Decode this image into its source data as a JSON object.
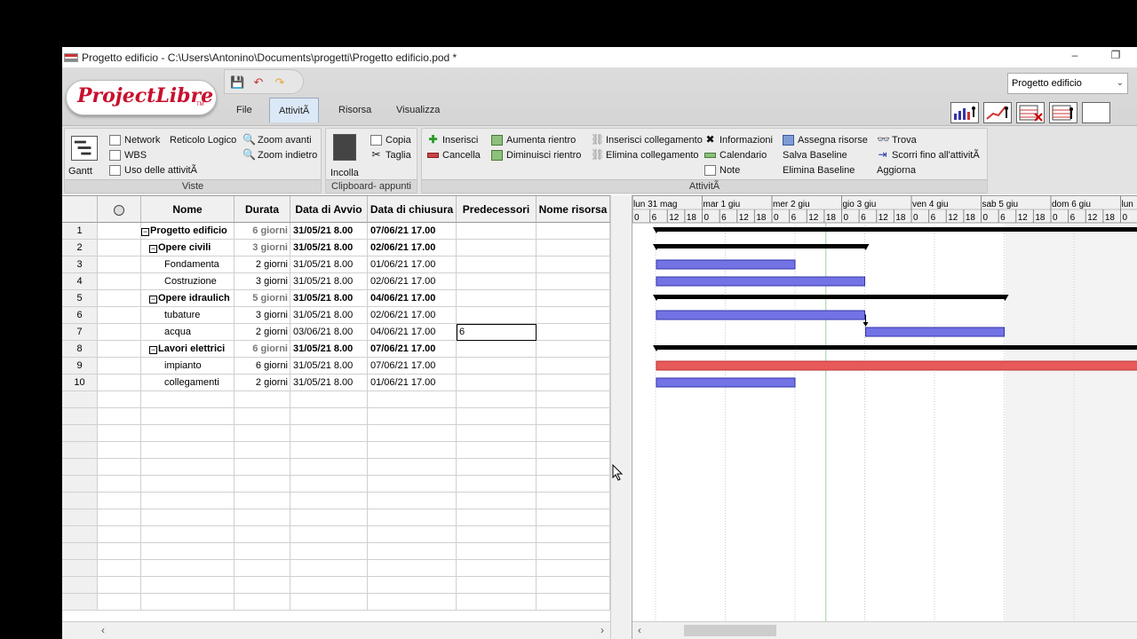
{
  "window": {
    "title": "Progetto edificio - C:\\Users\\Antonino\\Documents\\progetti\\Progetto edificio.pod *",
    "minimize": "–",
    "restore": "❐"
  },
  "logo": {
    "text": "ProjectLibre",
    "tm": "TM"
  },
  "tabs": [
    {
      "label": "File"
    },
    {
      "label": "AttivitÃ"
    },
    {
      "label": "Risorsa"
    },
    {
      "label": "Visualizza"
    }
  ],
  "project_select": {
    "value": "Progetto edificio"
  },
  "ribbon": {
    "viste": {
      "label": "Viste",
      "gantt": "Gantt",
      "network": "Network",
      "reticolo": "Reticolo Logico",
      "wbs": "WBS",
      "uso": "Uso delle attivitÃ",
      "zoom_in": "Zoom avanti",
      "zoom_out": "Zoom indietro"
    },
    "clipboard": {
      "label": "Clipboard- appunti",
      "incolla": "Incolla",
      "copia": "Copia",
      "taglia": "Taglia"
    },
    "attivita": {
      "label": "AttivitÃ",
      "inserisci": "Inserisci",
      "cancella": "Cancella",
      "aumenta": "Aumenta rientro",
      "diminuisci": "Diminuisci rientro",
      "ins_coll": "Inserisci collegamento",
      "elim_coll": "Elimina collegamento",
      "informazioni": "Informazioni",
      "calendario": "Calendario",
      "note": "Note",
      "assegna": "Assegna risorse",
      "salva_baseline": "Salva Baseline",
      "elimina_baseline": "Elimina Baseline",
      "trova": "Trova",
      "scorri": "Scorri fino all'attivitÃ",
      "aggiorna": "Aggiorna"
    }
  },
  "table": {
    "headers": [
      "",
      "",
      "Nome",
      "Durata",
      "Data di Avvio",
      "Data di chiusura",
      "Predecessori",
      "Nome risorsa"
    ],
    "rows": [
      {
        "id": "1",
        "name": "Progetto edificio",
        "dur": "6 giorni",
        "start": "31/05/21 8.00",
        "end": "07/06/21 17.00",
        "pred": "",
        "summary": true,
        "level": 0
      },
      {
        "id": "2",
        "name": "Opere civili",
        "dur": "3 giorni",
        "start": "31/05/21 8.00",
        "end": "02/06/21 17.00",
        "pred": "",
        "summary": true,
        "level": 1
      },
      {
        "id": "3",
        "name": "Fondamenta",
        "dur": "2 giorni",
        "start": "31/05/21 8.00",
        "end": "01/06/21 17.00",
        "pred": "",
        "summary": false,
        "level": 2
      },
      {
        "id": "4",
        "name": "Costruzione",
        "dur": "3 giorni",
        "start": "31/05/21 8.00",
        "end": "02/06/21 17.00",
        "pred": "",
        "summary": false,
        "level": 2
      },
      {
        "id": "5",
        "name": "Opere idraulich",
        "dur": "5 giorni",
        "start": "31/05/21 8.00",
        "end": "04/06/21 17.00",
        "pred": "",
        "summary": true,
        "level": 1
      },
      {
        "id": "6",
        "name": "tubature",
        "dur": "3 giorni",
        "start": "31/05/21 8.00",
        "end": "02/06/21 17.00",
        "pred": "",
        "summary": false,
        "level": 2
      },
      {
        "id": "7",
        "name": "acqua",
        "dur": "2 giorni",
        "start": "03/06/21 8.00",
        "end": "04/06/21 17.00",
        "pred": "6",
        "summary": false,
        "level": 2
      },
      {
        "id": "8",
        "name": "Lavori elettrici",
        "dur": "6 giorni",
        "start": "31/05/21 8.00",
        "end": "07/06/21 17.00",
        "pred": "",
        "summary": true,
        "level": 1
      },
      {
        "id": "9",
        "name": "impianto",
        "dur": "6 giorni",
        "start": "31/05/21 8.00",
        "end": "07/06/21 17.00",
        "pred": "",
        "summary": false,
        "level": 2
      },
      {
        "id": "10",
        "name": "collegamenti",
        "dur": "2 giorni",
        "start": "31/05/21 8.00",
        "end": "01/06/21 17.00",
        "pred": "",
        "summary": false,
        "level": 2
      }
    ]
  },
  "gantt": {
    "days": [
      "lun 31 mag",
      "mar 1 giu",
      "mer 2 giu",
      "gio 3 giu",
      "ven 4 giu",
      "sab 5 giu",
      "dom 6 giu",
      "lun"
    ],
    "hours": [
      "0",
      "6",
      "12",
      "18"
    ],
    "tasks": [
      {
        "row": 0,
        "start": 0,
        "end": 8,
        "type": "summary"
      },
      {
        "row": 1,
        "start": 0,
        "end": 3,
        "type": "summary"
      },
      {
        "row": 2,
        "start": 0,
        "end": 2,
        "type": "task"
      },
      {
        "row": 3,
        "start": 0,
        "end": 3,
        "type": "task"
      },
      {
        "row": 4,
        "start": 0,
        "end": 5,
        "type": "summary"
      },
      {
        "row": 5,
        "start": 0,
        "end": 3,
        "type": "task"
      },
      {
        "row": 6,
        "start": 3,
        "end": 5,
        "type": "task"
      },
      {
        "row": 7,
        "start": 0,
        "end": 8,
        "type": "summary"
      },
      {
        "row": 8,
        "start": 0,
        "end": 8,
        "type": "critical"
      },
      {
        "row": 9,
        "start": 0,
        "end": 2,
        "type": "task"
      }
    ],
    "link": {
      "from_row": 5,
      "to_row": 6
    },
    "colors": {
      "task": "#7373e6",
      "critical": "#e85a5a",
      "summary": "#000000",
      "weekend": "#f3f3f3"
    }
  }
}
